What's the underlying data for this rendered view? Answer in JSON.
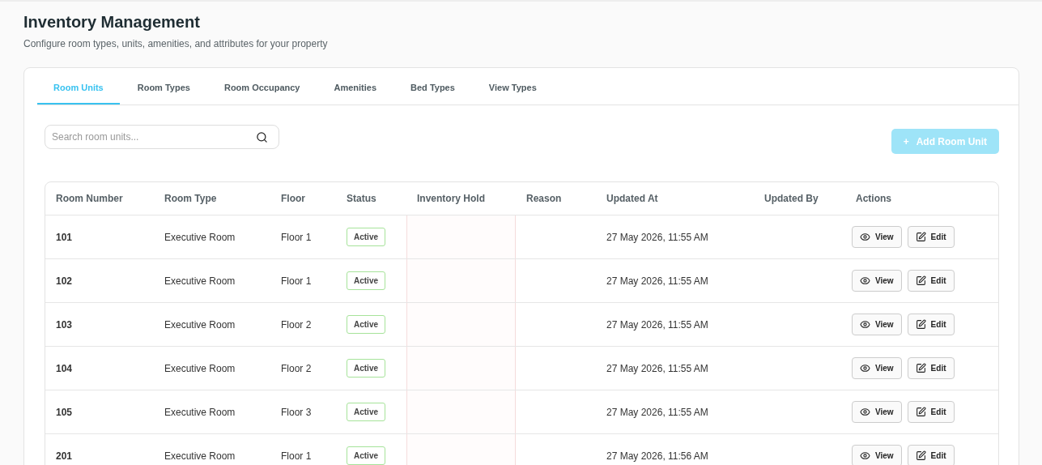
{
  "header": {
    "title": "Inventory Management",
    "subtitle": "Configure room types, units, amenities, and attributes for your property"
  },
  "tabs": [
    {
      "label": "Room Units",
      "selected": true
    },
    {
      "label": "Room Types",
      "selected": false
    },
    {
      "label": "Room Occupancy",
      "selected": false
    },
    {
      "label": "Amenities",
      "selected": false
    },
    {
      "label": "Bed Types",
      "selected": false
    },
    {
      "label": "View Types",
      "selected": false
    }
  ],
  "search": {
    "placeholder": "Search room units..."
  },
  "add_button": {
    "icon": "+",
    "label": "Add Room Unit",
    "disabled": true
  },
  "table": {
    "columns": [
      "Room Number",
      "Room Type",
      "Floor",
      "Status",
      "Inventory Hold",
      "Reason",
      "Updated At",
      "Updated By",
      "Actions"
    ],
    "rows": [
      {
        "room_number": "101",
        "room_type": "Executive Room",
        "floor": "Floor 1",
        "status": "Active",
        "updated_at": "27 May 2026, 11:55 AM",
        "actions": [
          "View",
          "Edit"
        ]
      },
      {
        "room_number": "102",
        "room_type": "Executive Room",
        "floor": "Floor 1",
        "status": "Active",
        "updated_at": "27 May 2026, 11:55 AM",
        "actions": [
          "View",
          "Edit"
        ]
      },
      {
        "room_number": "103",
        "room_type": "Executive Room",
        "floor": "Floor 2",
        "status": "Active",
        "updated_at": "27 May 2026, 11:55 AM",
        "actions": [
          "View",
          "Edit"
        ]
      },
      {
        "room_number": "104",
        "room_type": "Executive Room",
        "floor": "Floor 2",
        "status": "Active",
        "updated_at": "27 May 2026, 11:55 AM",
        "actions": [
          "View",
          "Edit"
        ]
      },
      {
        "room_number": "105",
        "room_type": "Executive Room",
        "floor": "Floor 3",
        "status": "Active",
        "updated_at": "27 May 2026, 11:55 AM",
        "actions": [
          "View",
          "Edit"
        ]
      },
      {
        "room_number": "201",
        "room_type": "Executive Room",
        "floor": "Floor 1",
        "status": "Active",
        "updated_at": "27 May 2026, 11:56 AM",
        "actions": [
          "View",
          "Edit"
        ]
      }
    ]
  }
}
